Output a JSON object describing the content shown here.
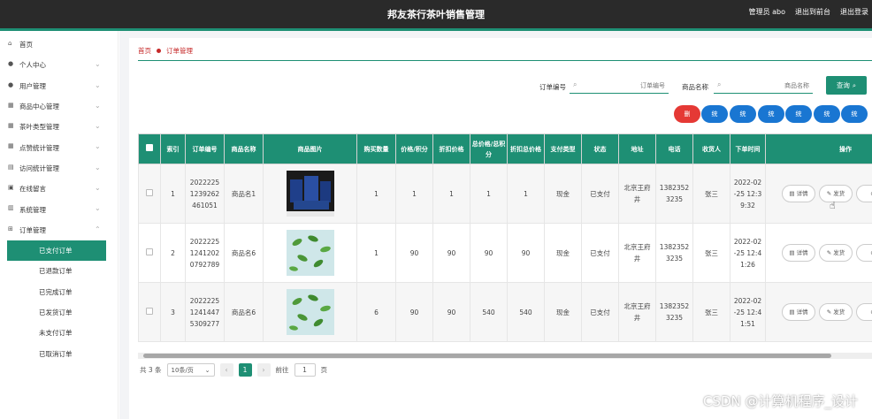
{
  "app": {
    "title": "邦友茶行茶叶销售管理",
    "user_label": "管理员 abo",
    "back_link": "退出到前台",
    "logout_link": "退出登录"
  },
  "sidebar": {
    "items": [
      {
        "label": "首页",
        "icon": "home-icon"
      },
      {
        "label": "个人中心",
        "icon": "user-icon"
      },
      {
        "label": "用户管理",
        "icon": "user-icon"
      },
      {
        "label": "商品中心管理",
        "icon": "grid-icon"
      },
      {
        "label": "茶叶类型管理",
        "icon": "grid-icon"
      },
      {
        "label": "点赞统计管理",
        "icon": "grid-icon"
      },
      {
        "label": "访问统计管理",
        "icon": "chart-icon"
      },
      {
        "label": "在线留言",
        "icon": "message-icon"
      },
      {
        "label": "系统管理",
        "icon": "settings-icon"
      },
      {
        "label": "订单管理",
        "icon": "cart-icon"
      }
    ],
    "sub_items": [
      {
        "label": "已支付订单",
        "active": true
      },
      {
        "label": "已退款订单",
        "active": false
      },
      {
        "label": "已完成订单",
        "active": false
      },
      {
        "label": "已发货订单",
        "active": false
      },
      {
        "label": "未支付订单",
        "active": false
      },
      {
        "label": "已取消订单",
        "active": false
      }
    ]
  },
  "breadcrumb": {
    "home": "首页",
    "current": "订单管理"
  },
  "search": {
    "order_no_label": "订单编号",
    "order_no_placeholder": "订单编号",
    "product_label": "商品名称",
    "product_placeholder": "商品名称",
    "query_label": "查询"
  },
  "toolbar": {
    "delete_label": "删",
    "buttons": [
      "统",
      "统",
      "统",
      "统",
      "统",
      "统"
    ]
  },
  "table": {
    "headers": [
      "索引",
      "订单编号",
      "商品名称",
      "商品图片",
      "购买数量",
      "价格/积分",
      "折扣价格",
      "总价格/总积分",
      "折扣总价格",
      "支付类型",
      "状态",
      "地址",
      "电话",
      "收货人",
      "下单时间",
      "操作"
    ],
    "rows": [
      {
        "index": "1",
        "order_no": "2022225\n1239262\n461051",
        "product": "商品名1",
        "image": "blue-tea-boxes",
        "qty": "1",
        "price": "1",
        "discount_price": "1",
        "total": "1",
        "discount_total": "1",
        "pay_type": "现金",
        "status": "已支付",
        "address": "北京王府\n井",
        "phone": "1382352\n3235",
        "receiver": "张三",
        "time": "2022-02\n-25 12:3\n9:32"
      },
      {
        "index": "2",
        "order_no": "2022225\n1241202\n0792789",
        "product": "商品名6",
        "image": "green-tea-leaves",
        "qty": "1",
        "price": "90",
        "discount_price": "90",
        "total": "90",
        "discount_total": "90",
        "pay_type": "现金",
        "status": "已支付",
        "address": "北京王府\n井",
        "phone": "1382352\n3235",
        "receiver": "张三",
        "time": "2022-02\n-25 12:4\n1:26"
      },
      {
        "index": "3",
        "order_no": "2022225\n1241447\n5309277",
        "product": "商品名6",
        "image": "green-tea-leaves",
        "qty": "6",
        "price": "90",
        "discount_price": "90",
        "total": "540",
        "discount_total": "540",
        "pay_type": "现金",
        "status": "已支付",
        "address": "北京王府\n井",
        "phone": "1382352\n3235",
        "receiver": "张三",
        "time": "2022-02\n-25 12:4\n1:51"
      }
    ],
    "actions": {
      "detail": "详情",
      "ship": "发货"
    }
  },
  "pager": {
    "total": "共 3 条",
    "page_size": "10条/页",
    "current_page": "1",
    "goto_label": "前往",
    "goto_value": "1",
    "page_unit": "页"
  },
  "watermark": "CSDN @计算机程序_设计",
  "colors": {
    "accent": "#1e8f74",
    "header_bg": "#2a2a2a",
    "button_blue": "#1976d2",
    "button_red": "#e53935"
  }
}
